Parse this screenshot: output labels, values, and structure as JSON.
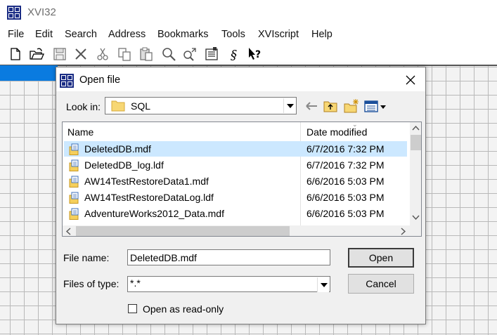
{
  "app": {
    "title": "XVI32",
    "menu": [
      "File",
      "Edit",
      "Search",
      "Address",
      "Bookmarks",
      "Tools",
      "XVIscript",
      "Help"
    ]
  },
  "toolbar_icons": [
    "new-file-icon",
    "open-folder-icon",
    "save-icon",
    "cut-x-icon",
    "scissors-icon",
    "copy-icon",
    "paste-icon",
    "find-icon",
    "find-next-icon",
    "properties-icon",
    "script-icon",
    "context-help-icon"
  ],
  "dialog": {
    "title": "Open file",
    "look_in_label": "Look in:",
    "look_in_value": "SQL",
    "columns": {
      "name": "Name",
      "date": "Date modified"
    },
    "files": [
      {
        "name": "DeletedDB.mdf",
        "date": "6/7/2016 7:32 PM",
        "selected": true
      },
      {
        "name": "DeletedDB_log.ldf",
        "date": "6/7/2016 7:32 PM",
        "selected": false
      },
      {
        "name": "AW14TestRestoreData1.mdf",
        "date": "6/6/2016 5:03 PM",
        "selected": false
      },
      {
        "name": "AW14TestRestoreDataLog.ldf",
        "date": "6/6/2016 5:03 PM",
        "selected": false
      },
      {
        "name": "AdventureWorks2012_Data.mdf",
        "date": "6/6/2016 5:03 PM",
        "selected": false
      }
    ],
    "file_name_label": "File name:",
    "file_name_value": "DeletedDB.mdf",
    "files_of_type_label": "Files of type:",
    "files_of_type_value": "*.*",
    "open_label": "Open",
    "cancel_label": "Cancel",
    "read_only_label": "Open as read-only",
    "read_only_checked": false
  },
  "colors": {
    "selection": "#cce8ff",
    "hex_selection": "#0a7be0",
    "logo": "#1b2d85"
  }
}
